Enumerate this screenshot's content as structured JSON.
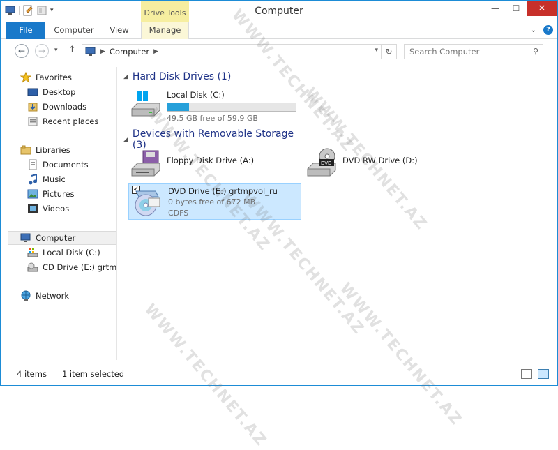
{
  "window": {
    "title": "Computer"
  },
  "titlebar": {
    "context_tab_group": "Drive Tools",
    "buttons": {
      "minimize": "—",
      "maximize": "☐",
      "close": "✕"
    }
  },
  "ribbon": {
    "tabs": [
      {
        "label": "File"
      },
      {
        "label": "Computer"
      },
      {
        "label": "View"
      },
      {
        "label": "Manage"
      }
    ]
  },
  "address": {
    "crumbs": [
      "Computer"
    ],
    "search_placeholder": "Search Computer"
  },
  "nav": {
    "favorites": {
      "label": "Favorites",
      "items": [
        "Desktop",
        "Downloads",
        "Recent places"
      ]
    },
    "libraries": {
      "label": "Libraries",
      "items": [
        "Documents",
        "Music",
        "Pictures",
        "Videos"
      ]
    },
    "computer": {
      "label": "Computer",
      "items": [
        "Local Disk (C:)",
        "CD Drive (E:) grtmpv"
      ]
    },
    "network": {
      "label": "Network"
    }
  },
  "content": {
    "groups": [
      {
        "title": "Hard Disk Drives (1)"
      },
      {
        "title": "Devices with Removable Storage (3)"
      }
    ],
    "drives": {
      "c": {
        "name": "Local Disk (C:)",
        "free": "49.5 GB free of 59.9 GB",
        "used_fraction": 0.17
      },
      "a": {
        "name": "Floppy Disk Drive (A:)"
      },
      "d": {
        "name": "DVD RW Drive (D:)"
      },
      "e": {
        "name": "DVD Drive (E:) grtmpvol_ru",
        "free": "0 bytes free of 672 MB",
        "fs": "CDFS"
      }
    }
  },
  "status": {
    "items": "4 items",
    "selected": "1 item selected"
  },
  "watermark": "WWW.TECHNET.AZ",
  "colors": {
    "accent": "#1979ca",
    "selection": "#cce8ff",
    "progress": "#26a0da",
    "close": "#c7302a"
  }
}
